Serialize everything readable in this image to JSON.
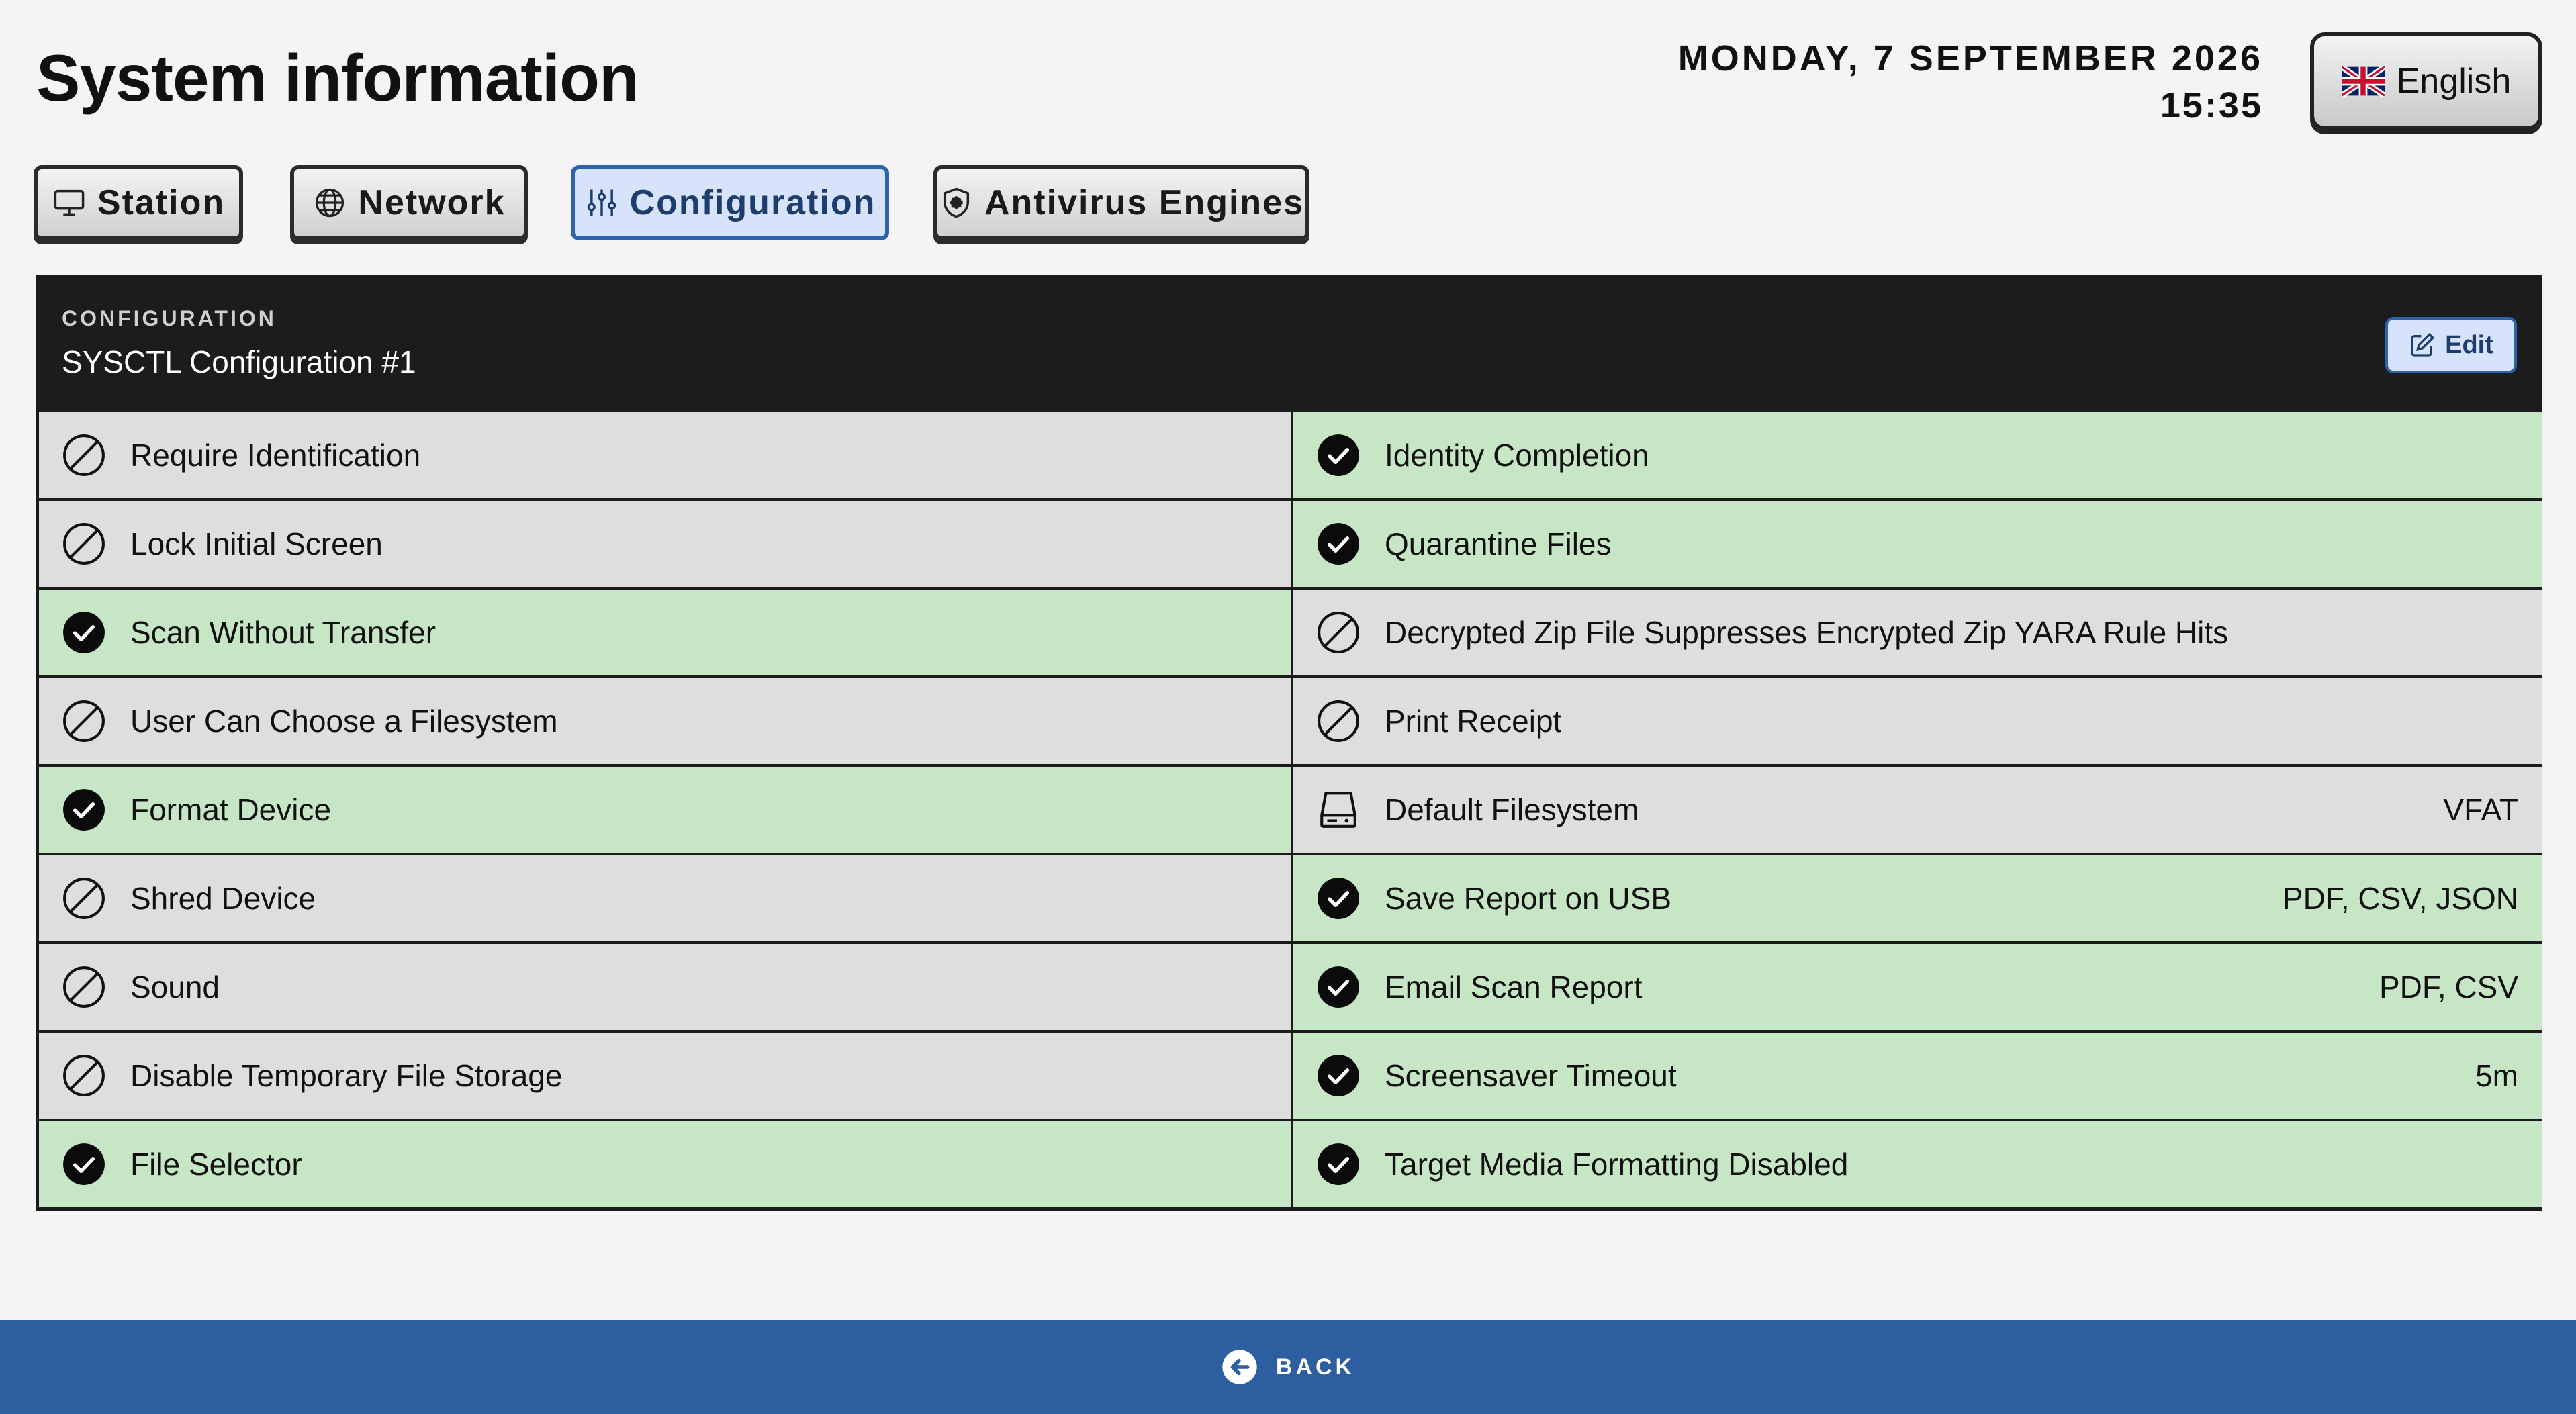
{
  "page": {
    "title": "System information"
  },
  "header": {
    "date": "MONDAY, 7 SEPTEMBER 2026",
    "time": "15:35",
    "language": "English"
  },
  "tabs": [
    {
      "label": "Station",
      "icon": "monitor-icon",
      "active": false
    },
    {
      "label": "Network",
      "icon": "globe-icon",
      "active": false
    },
    {
      "label": "Configuration",
      "icon": "sliders-icon",
      "active": true
    },
    {
      "label": "Antivirus Engines",
      "icon": "shield-icon",
      "active": false
    }
  ],
  "panel": {
    "label": "CONFIGURATION",
    "title": "SYSCTL Configuration #1",
    "edit_label": "Edit"
  },
  "left_settings": [
    {
      "label": "Require Identification",
      "enabled": false
    },
    {
      "label": "Lock Initial Screen",
      "enabled": false
    },
    {
      "label": "Scan Without Transfer",
      "enabled": true
    },
    {
      "label": "User Can Choose a Filesystem",
      "enabled": false
    },
    {
      "label": "Format Device",
      "enabled": true
    },
    {
      "label": "Shred Device",
      "enabled": false
    },
    {
      "label": "Sound",
      "enabled": false
    },
    {
      "label": "Disable Temporary File Storage",
      "enabled": false
    },
    {
      "label": "File Selector",
      "enabled": true
    }
  ],
  "right_settings": [
    {
      "label": "Identity Completion",
      "enabled": true,
      "value": ""
    },
    {
      "label": "Quarantine Files",
      "enabled": true,
      "value": ""
    },
    {
      "label": "Decrypted Zip File Suppresses Encrypted Zip YARA Rule Hits",
      "enabled": false,
      "value": ""
    },
    {
      "label": "Print Receipt",
      "enabled": false,
      "value": ""
    },
    {
      "label": "Default Filesystem",
      "enabled": false,
      "icon": "drive-icon",
      "value": "VFAT"
    },
    {
      "label": "Save Report on USB",
      "enabled": true,
      "value": "PDF, CSV, JSON"
    },
    {
      "label": "Email Scan Report",
      "enabled": true,
      "value": "PDF, CSV"
    },
    {
      "label": "Screensaver Timeout",
      "enabled": true,
      "value": "5m"
    },
    {
      "label": "Target Media Formatting Disabled",
      "enabled": true,
      "value": ""
    }
  ],
  "footer": {
    "back_label": "BACK"
  },
  "colors": {
    "enabled_row": "#c7e6c5",
    "disabled_row": "#dedede",
    "accent": "#2d5fa0",
    "header_bg": "#1c1c1c"
  }
}
